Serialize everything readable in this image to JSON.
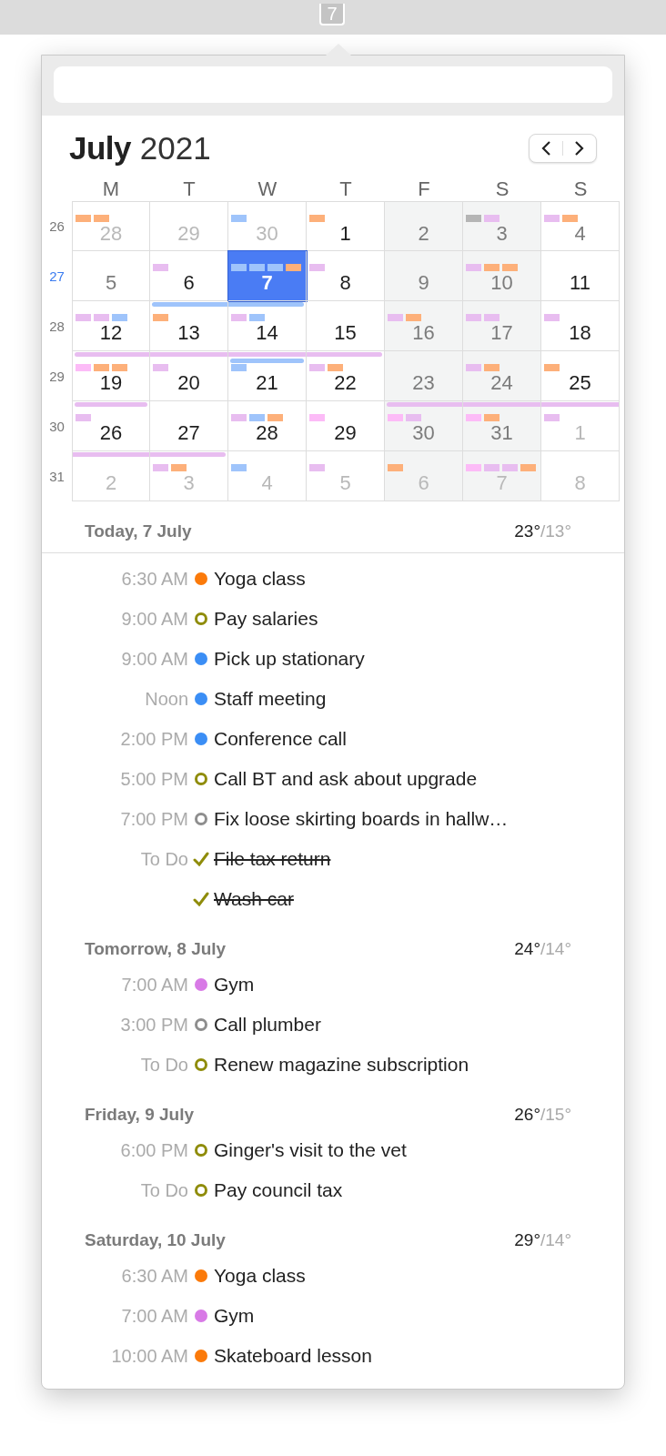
{
  "menu_bar": {
    "icon_text": "7"
  },
  "calendar": {
    "month": "July",
    "year": "2021",
    "weekdays": [
      "M",
      "T",
      "W",
      "T",
      "F",
      "S",
      "S"
    ],
    "weeks": [
      {
        "week": "26",
        "current": false,
        "days": [
          {
            "day": "28",
            "in_month": false,
            "shaded": false,
            "selected": false,
            "marks": [
              {
                "color": "#fdb07a"
              },
              {
                "color": "#fdb07a"
              }
            ]
          },
          {
            "day": "29",
            "in_month": false,
            "shaded": false,
            "selected": false
          },
          {
            "day": "30",
            "in_month": false,
            "shaded": false,
            "selected": false,
            "marks": [
              {
                "color": "#9fc4fb"
              }
            ]
          },
          {
            "day": "1",
            "in_month": true,
            "shaded": false,
            "off": false,
            "selected": false,
            "marks": [
              {
                "color": "#fdb07a"
              }
            ]
          },
          {
            "day": "2",
            "in_month": true,
            "shaded": true,
            "off": true,
            "selected": false
          },
          {
            "day": "3",
            "in_month": true,
            "shaded": true,
            "off": true,
            "selected": false,
            "marks": [
              {
                "color": "#b5b5b5"
              },
              {
                "color": "#e8bdf0"
              }
            ]
          },
          {
            "day": "4",
            "in_month": true,
            "shaded": false,
            "off": true,
            "selected": false,
            "marks": [
              {
                "color": "#e8bdf0"
              },
              {
                "color": "#fdb07a"
              }
            ]
          }
        ]
      },
      {
        "week": "27",
        "current": true,
        "days": [
          {
            "day": "5",
            "in_month": true,
            "shaded": false,
            "off": true,
            "selected": false
          },
          {
            "day": "6",
            "in_month": true,
            "shaded": false,
            "off": false,
            "selected": false,
            "marks": [
              {
                "color": "#e8bdf0"
              }
            ]
          },
          {
            "day": "7",
            "in_month": true,
            "shaded": false,
            "off": false,
            "selected": true,
            "marks": [
              {
                "color": "#9fc4fb"
              },
              {
                "color": "#9fc4fb"
              },
              {
                "color": "#9fc4fb"
              },
              {
                "color": "#fdb07a"
              }
            ]
          },
          {
            "day": "8",
            "in_month": true,
            "shaded": false,
            "off": false,
            "selected": false,
            "marks": [
              {
                "color": "#e8bdf0"
              }
            ]
          },
          {
            "day": "9",
            "in_month": true,
            "shaded": true,
            "off": true,
            "selected": false
          },
          {
            "day": "10",
            "in_month": true,
            "shaded": true,
            "off": true,
            "selected": false,
            "marks": [
              {
                "color": "#e8bdf0"
              },
              {
                "color": "#fdb07a"
              },
              {
                "color": "#fdb07a"
              }
            ]
          },
          {
            "day": "11",
            "in_month": true,
            "shaded": false,
            "off": false,
            "selected": false
          }
        ]
      },
      {
        "week": "28",
        "current": false,
        "days": [
          {
            "day": "12",
            "in_month": true,
            "shaded": false,
            "off": false,
            "selected": false,
            "marks": [
              {
                "color": "#e8bdf0"
              },
              {
                "color": "#e8bdf0"
              },
              {
                "color": "#9fc4fb"
              }
            ]
          },
          {
            "day": "13",
            "in_month": true,
            "shaded": false,
            "off": false,
            "selected": false,
            "bars": [
              {
                "color": "#9fc4fb",
                "kind": "start"
              }
            ],
            "marks": [
              {
                "color": "#fdb07a"
              }
            ]
          },
          {
            "day": "14",
            "in_month": true,
            "shaded": false,
            "off": false,
            "selected": false,
            "bars": [
              {
                "color": "#9fc4fb",
                "kind": "end"
              }
            ],
            "marks": [
              {
                "color": "#e8bdf0"
              },
              {
                "color": "#9fc4fb"
              }
            ]
          },
          {
            "day": "15",
            "in_month": true,
            "shaded": false,
            "off": false,
            "selected": false
          },
          {
            "day": "16",
            "in_month": true,
            "shaded": true,
            "off": true,
            "selected": false,
            "marks": [
              {
                "color": "#e8bdf0"
              },
              {
                "color": "#fdb07a"
              }
            ]
          },
          {
            "day": "17",
            "in_month": true,
            "shaded": true,
            "off": true,
            "selected": false,
            "marks": [
              {
                "color": "#e8bdf0"
              },
              {
                "color": "#e8bdf0"
              }
            ]
          },
          {
            "day": "18",
            "in_month": true,
            "shaded": false,
            "off": false,
            "selected": false,
            "marks": [
              {
                "color": "#e8bdf0"
              }
            ]
          }
        ]
      },
      {
        "week": "29",
        "current": false,
        "days": [
          {
            "day": "19",
            "in_month": true,
            "shaded": false,
            "off": false,
            "selected": false,
            "bars": [
              {
                "color": "#e8bdf0",
                "kind": "start"
              }
            ],
            "marks": [
              {
                "color": "#fcbbf7"
              },
              {
                "color": "#fdb07a"
              },
              {
                "color": "#fdb07a"
              }
            ]
          },
          {
            "day": "20",
            "in_month": true,
            "shaded": false,
            "off": false,
            "selected": false,
            "bars": [
              {
                "color": "#e8bdf0",
                "kind": "middle"
              }
            ],
            "marks": [
              {
                "color": "#e8bdf0"
              }
            ]
          },
          {
            "day": "21",
            "in_month": true,
            "shaded": false,
            "off": false,
            "selected": false,
            "bars": [
              {
                "color": "#e8bdf0",
                "kind": "middle"
              },
              {
                "color": "#9fc4fb",
                "kind": "single"
              }
            ],
            "marks": [
              {
                "color": "#9fc4fb"
              }
            ]
          },
          {
            "day": "22",
            "in_month": true,
            "shaded": false,
            "off": false,
            "selected": false,
            "bars": [
              {
                "color": "#e8bdf0",
                "kind": "end"
              }
            ],
            "marks": [
              {
                "color": "#e8bdf0"
              },
              {
                "color": "#fdb07a"
              }
            ]
          },
          {
            "day": "23",
            "in_month": true,
            "shaded": true,
            "off": true,
            "selected": false
          },
          {
            "day": "24",
            "in_month": true,
            "shaded": true,
            "off": true,
            "selected": false,
            "marks": [
              {
                "color": "#e8bdf0"
              },
              {
                "color": "#fdb07a"
              }
            ]
          },
          {
            "day": "25",
            "in_month": true,
            "shaded": false,
            "off": false,
            "selected": false,
            "marks": [
              {
                "color": "#fdb07a"
              }
            ]
          }
        ]
      },
      {
        "week": "30",
        "current": false,
        "days": [
          {
            "day": "26",
            "in_month": true,
            "shaded": false,
            "off": false,
            "selected": false,
            "bars": [
              {
                "color": "#e8bdf0",
                "kind": "single"
              }
            ],
            "marks": [
              {
                "color": "#e8bdf0"
              }
            ]
          },
          {
            "day": "27",
            "in_month": true,
            "shaded": false,
            "off": false,
            "selected": false
          },
          {
            "day": "28",
            "in_month": true,
            "shaded": false,
            "off": false,
            "selected": false,
            "marks": [
              {
                "color": "#e8bdf0"
              },
              {
                "color": "#9fc4fb"
              },
              {
                "color": "#fdb07a"
              }
            ]
          },
          {
            "day": "29",
            "in_month": true,
            "shaded": false,
            "off": false,
            "selected": false,
            "marks": [
              {
                "color": "#fcbbf7"
              }
            ]
          },
          {
            "day": "30",
            "in_month": true,
            "shaded": true,
            "off": true,
            "selected": false,
            "bars": [
              {
                "color": "#e8bdf0",
                "kind": "start"
              }
            ],
            "marks": [
              {
                "color": "#fcbbf7"
              },
              {
                "color": "#e8bdf0"
              }
            ]
          },
          {
            "day": "31",
            "in_month": true,
            "shaded": true,
            "off": true,
            "selected": false,
            "bars": [
              {
                "color": "#e8bdf0",
                "kind": "middle"
              }
            ],
            "marks": [
              {
                "color": "#fcbbf7"
              },
              {
                "color": "#fdb07a"
              }
            ]
          },
          {
            "day": "1",
            "in_month": false,
            "shaded": false,
            "selected": false,
            "bars": [
              {
                "color": "#e8bdf0",
                "kind": "middle"
              }
            ],
            "marks": [
              {
                "color": "#e8bdf0"
              }
            ]
          }
        ]
      },
      {
        "week": "31",
        "current": false,
        "days": [
          {
            "day": "2",
            "in_month": false,
            "shaded": false,
            "selected": false,
            "bars": [
              {
                "color": "#e8bdf0",
                "kind": "middle"
              }
            ]
          },
          {
            "day": "3",
            "in_month": false,
            "shaded": false,
            "selected": false,
            "bars": [
              {
                "color": "#e8bdf0",
                "kind": "end"
              }
            ],
            "marks": [
              {
                "color": "#e8bdf0"
              },
              {
                "color": "#fdb07a"
              }
            ]
          },
          {
            "day": "4",
            "in_month": false,
            "shaded": false,
            "selected": false,
            "marks": [
              {
                "color": "#9fc4fb"
              }
            ]
          },
          {
            "day": "5",
            "in_month": false,
            "shaded": false,
            "selected": false,
            "marks": [
              {
                "color": "#e8bdf0"
              }
            ]
          },
          {
            "day": "6",
            "in_month": false,
            "shaded": true,
            "selected": false,
            "marks": [
              {
                "color": "#fdb07a"
              }
            ]
          },
          {
            "day": "7",
            "in_month": false,
            "shaded": true,
            "selected": false,
            "marks": [
              {
                "color": "#fcbbf7"
              },
              {
                "color": "#e8bdf0"
              },
              {
                "color": "#e8bdf0"
              },
              {
                "color": "#fdb07a"
              }
            ]
          },
          {
            "day": "8",
            "in_month": false,
            "shaded": false,
            "selected": false
          }
        ]
      }
    ]
  },
  "agenda": [
    {
      "heading": "Today, 7 July",
      "high": "23°",
      "low": "/13°",
      "items": [
        {
          "time": "6:30 AM",
          "title": "Yoga class",
          "kind": "event",
          "color": "#fb7a0a"
        },
        {
          "time": "9:00 AM",
          "title": "Pay salaries",
          "kind": "task",
          "color": "#8f8c0a",
          "done": false
        },
        {
          "time": "9:00 AM",
          "title": "Pick up stationary",
          "kind": "event",
          "color": "#3b8ef5"
        },
        {
          "time": "Noon",
          "title": "Staff meeting",
          "kind": "event",
          "color": "#3b8ef5"
        },
        {
          "time": "2:00 PM",
          "title": "Conference call",
          "kind": "event",
          "color": "#3b8ef5"
        },
        {
          "time": "5:00 PM",
          "title": "Call BT and ask about upgrade",
          "kind": "task",
          "color": "#8f8c0a",
          "done": false
        },
        {
          "time": "7:00 PM",
          "title": "Fix loose skirting boards in hallw…",
          "kind": "task",
          "color": "#8e8e8e",
          "done": false
        },
        {
          "time": "To Do",
          "title": "File tax return",
          "kind": "task",
          "color": "#8f8c0a",
          "done": true
        },
        {
          "title": "Wash car",
          "kind": "task",
          "color": "#8f8c0a",
          "done": true
        }
      ]
    },
    {
      "heading": "Tomorrow, 8 July",
      "high": "24°",
      "low": "/14°",
      "items": [
        {
          "time": "7:00 AM",
          "title": "Gym",
          "kind": "event",
          "color": "#d87ae6"
        },
        {
          "time": "3:00 PM",
          "title": "Call plumber",
          "kind": "task",
          "color": "#8e8e8e",
          "done": false
        },
        {
          "time": "To Do",
          "title": "Renew magazine subscription",
          "kind": "task",
          "color": "#8f8c0a",
          "done": false
        }
      ]
    },
    {
      "heading": "Friday, 9 July",
      "high": "26°",
      "low": "/15°",
      "items": [
        {
          "time": "6:00 PM",
          "title": "Ginger's visit to the vet",
          "kind": "task",
          "color": "#8f8c0a",
          "done": false
        },
        {
          "time": "To Do",
          "title": "Pay council tax",
          "kind": "task",
          "color": "#8f8c0a",
          "done": false
        }
      ]
    },
    {
      "heading": "Saturday, 10 July",
      "high": "29°",
      "low": "/14°",
      "items": [
        {
          "time": "6:30 AM",
          "title": "Yoga class",
          "kind": "event",
          "color": "#fb7a0a"
        },
        {
          "time": "7:00 AM",
          "title": "Gym",
          "kind": "event",
          "color": "#d87ae6"
        },
        {
          "time": "10:00 AM",
          "title": "Skateboard lesson",
          "kind": "event",
          "color": "#fb7a0a"
        }
      ]
    }
  ]
}
